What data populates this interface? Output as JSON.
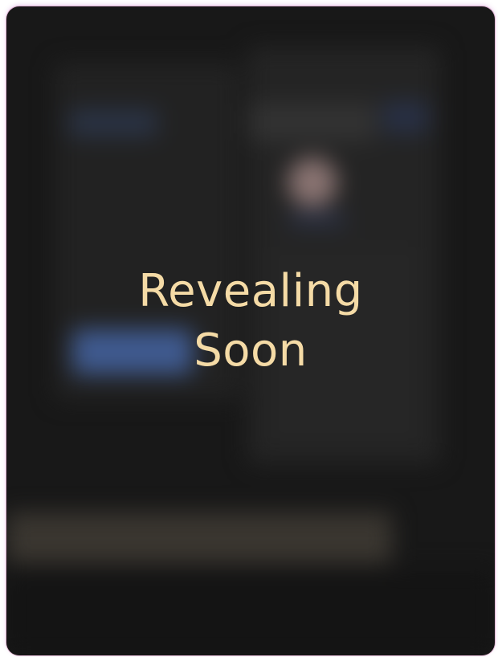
{
  "card": {
    "status_text": "Revealing Soon"
  },
  "colors": {
    "background": "#181818",
    "text": "#f5dba6",
    "border_glow": "#c878d2"
  }
}
